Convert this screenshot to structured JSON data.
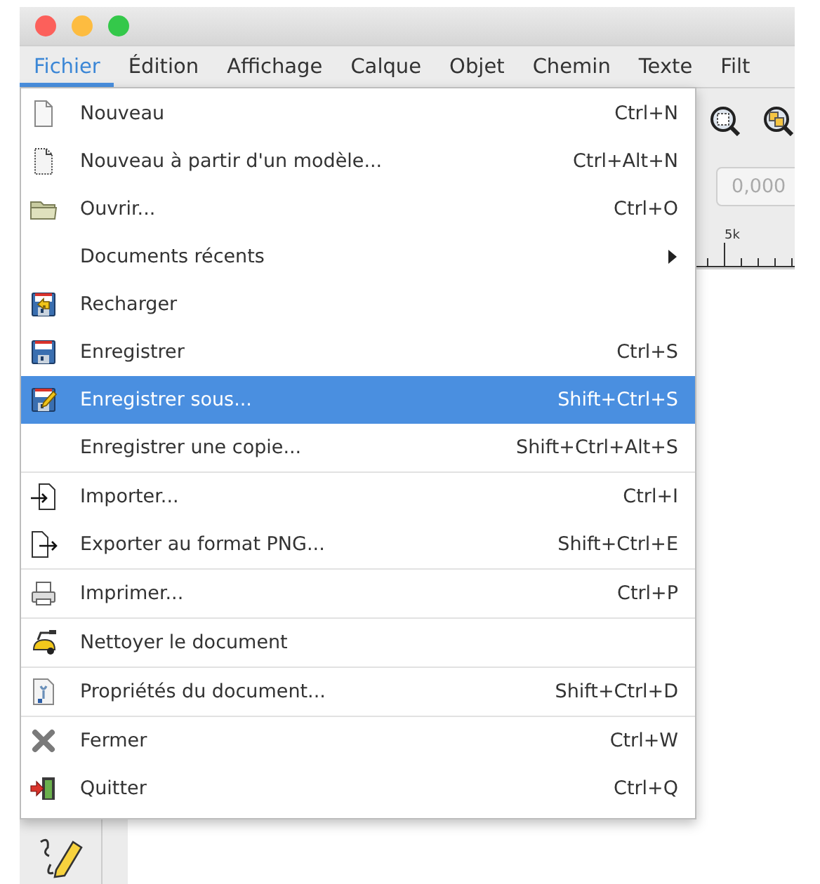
{
  "menubar": [
    {
      "label": "Fichier",
      "selected": true
    },
    {
      "label": "Édition",
      "selected": false
    },
    {
      "label": "Affichage",
      "selected": false
    },
    {
      "label": "Calque",
      "selected": false
    },
    {
      "label": "Objet",
      "selected": false
    },
    {
      "label": "Chemin",
      "selected": false
    },
    {
      "label": "Texte",
      "selected": false
    },
    {
      "label": "Filt",
      "selected": false
    }
  ],
  "menu": {
    "groups": [
      {
        "items": [
          {
            "label": "Nouveau",
            "shortcut": "Ctrl+N",
            "selected": false
          },
          {
            "label": "Nouveau à partir d'un modèle...",
            "shortcut": "Ctrl+Alt+N",
            "selected": false
          },
          {
            "label": "Ouvrir...",
            "shortcut": "Ctrl+O",
            "selected": false
          },
          {
            "label": "Documents récents",
            "submenu": true,
            "selected": false
          },
          {
            "label": "Recharger",
            "selected": false
          },
          {
            "label": "Enregistrer",
            "shortcut": "Ctrl+S",
            "selected": false
          },
          {
            "label": "Enregistrer sous...",
            "shortcut": "Shift+Ctrl+S",
            "selected": true
          },
          {
            "label": "Enregistrer une copie...",
            "shortcut": "Shift+Ctrl+Alt+S",
            "selected": false
          }
        ]
      },
      {
        "items": [
          {
            "label": "Importer...",
            "shortcut": "Ctrl+I",
            "selected": false
          },
          {
            "label": "Exporter au format PNG...",
            "shortcut": "Shift+Ctrl+E",
            "selected": false
          }
        ]
      },
      {
        "items": [
          {
            "label": "Imprimer...",
            "shortcut": "Ctrl+P",
            "selected": false
          }
        ]
      },
      {
        "items": [
          {
            "label": "Nettoyer le document",
            "selected": false
          }
        ]
      },
      {
        "items": [
          {
            "label": "Propriétés du document...",
            "shortcut": "Shift+Ctrl+D",
            "selected": false
          }
        ]
      },
      {
        "items": [
          {
            "label": "Fermer",
            "shortcut": "Ctrl+W",
            "selected": false
          },
          {
            "label": "Quitter",
            "shortcut": "Ctrl+Q",
            "selected": false
          }
        ]
      }
    ]
  },
  "toolbar": {
    "field_value": "0,000"
  },
  "ruler": {
    "label": "5k"
  }
}
